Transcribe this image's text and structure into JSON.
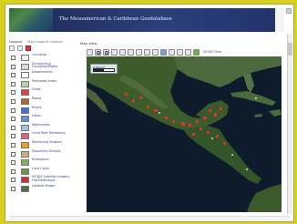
{
  "banner": {
    "title": "The Mesoamerican & Caribbean Geodatabase"
  },
  "legend": {
    "title": "Legend",
    "subtitle": "Map Legend Options",
    "items": [
      {
        "label": "Countries",
        "symbol_color": "#f0f0f0"
      },
      {
        "label": "Surrounding Countries/States",
        "symbol_color": "#d8d8d8"
      },
      {
        "label": "Departments",
        "symbol_color": "#ffffff"
      },
      {
        "label": "Protected Areas",
        "symbol_color": "#b4d8a0"
      },
      {
        "label": "Cities",
        "symbol_color": "#e04040"
      },
      {
        "label": "Roads",
        "symbol_color": "#c06030"
      },
      {
        "label": "Rivers",
        "symbol_color": "#4070d0"
      },
      {
        "label": "Lakes",
        "symbol_color": "#6090e0"
      },
      {
        "label": "Watersheds",
        "symbol_color": "#a0c0e8"
      },
      {
        "label": "Coral Reef Monitoring",
        "symbol_color": "#e06090"
      },
      {
        "label": "Monitoring Stations",
        "symbol_color": "#f0a020"
      },
      {
        "label": "Population Density",
        "symbol_color": "#c8b080"
      },
      {
        "label": "Ecoregions",
        "symbol_color": "#80b060"
      },
      {
        "label": "Land Cover",
        "symbol_color": "#6a9a40"
      },
      {
        "label": "MODIS Satellite Imagery Fire Detections",
        "symbol_color": "#d03030"
      },
      {
        "label": "Landsat Mosaic",
        "symbol_color": "#507040"
      }
    ]
  },
  "map": {
    "panel_label": "Map View",
    "toolbar_label": "MODIS Fires",
    "scalebar_text": "0   500 km",
    "colors": {
      "ocean": "#0d1b2a",
      "land": "#3b5a2e",
      "fire": "#e03030"
    }
  }
}
